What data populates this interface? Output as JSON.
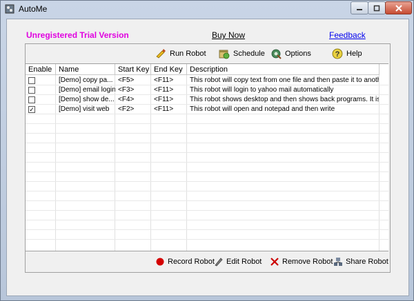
{
  "window": {
    "title": "AutoMe"
  },
  "header": {
    "trial_text": "Unregistered Trial Version",
    "buy_now": "Buy Now",
    "feedback": "Feedback"
  },
  "toolbar": {
    "run_robot": "Run Robot",
    "schedule": "Schedule",
    "options": "Options",
    "help": "Help"
  },
  "table": {
    "columns": [
      "Enable",
      "Name",
      "Start Key",
      "End Key",
      "Description"
    ],
    "rows": [
      {
        "enabled": false,
        "name": "[Demo] copy pa...",
        "start_key": "<F5>",
        "end_key": "<F11>",
        "description": "This robot will copy text from one file and then paste it to another f..."
      },
      {
        "enabled": false,
        "name": "[Demo] email login",
        "start_key": "<F3>",
        "end_key": "<F11>",
        "description": "This robot will login to yahoo mail automatically"
      },
      {
        "enabled": false,
        "name": "[Demo] show de...",
        "start_key": "<F4>",
        "end_key": "<F11>",
        "description": "This robot shows desktop and then shows back programs. It is cr..."
      },
      {
        "enabled": true,
        "name": "[Demo] visit web",
        "start_key": "<F2>",
        "end_key": "<F11>",
        "description": "This robot will open and notepad and then write"
      }
    ]
  },
  "bottom": {
    "record_robot": "Record Robot",
    "edit_robot": "Edit Robot",
    "remove_robot": "Remove Robot",
    "share_robot": "Share Robot"
  },
  "colors": {
    "trial": "#e000e0",
    "link": "#0000ee",
    "record": "#d40000",
    "remove": "#cc0000"
  }
}
